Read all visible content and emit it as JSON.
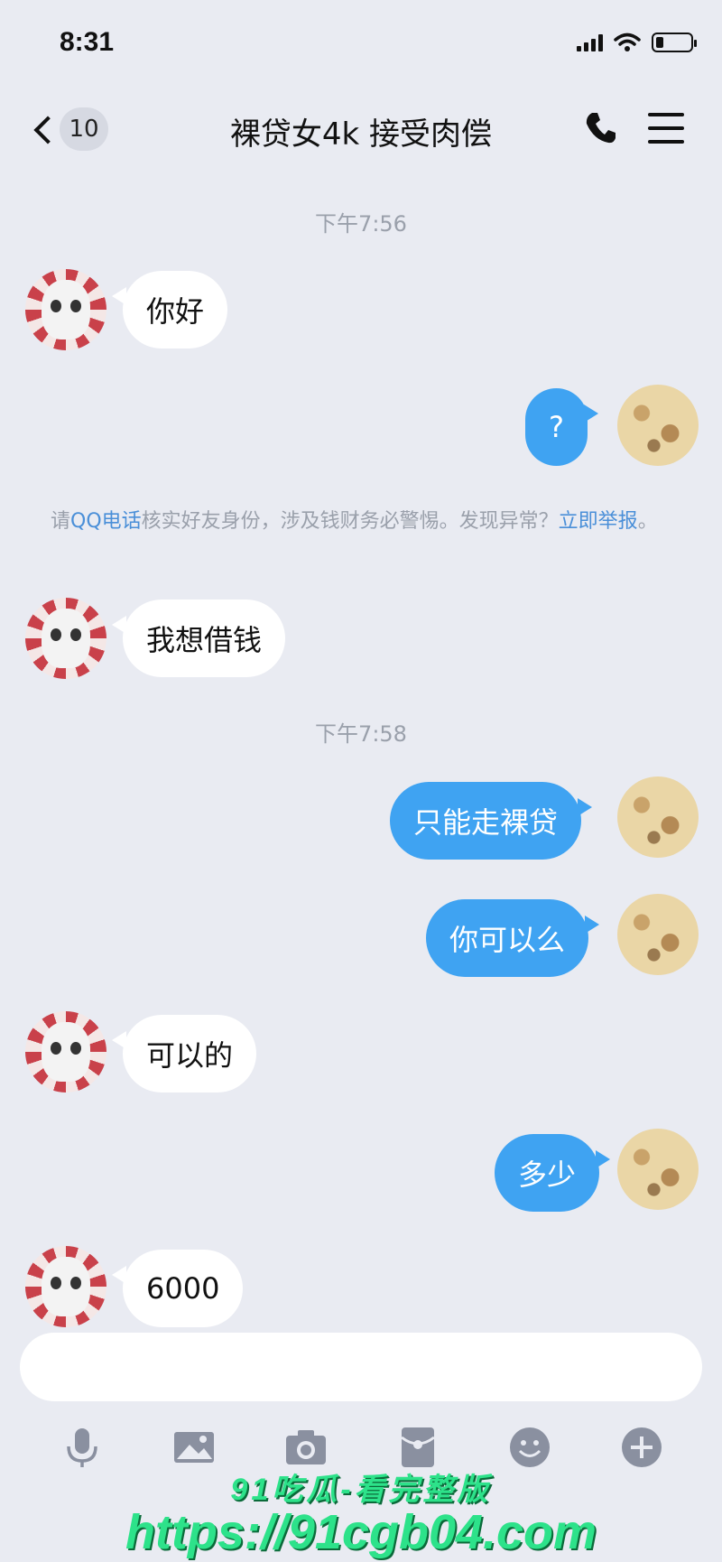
{
  "status_bar": {
    "time": "8:31"
  },
  "nav": {
    "unread_count": "10",
    "title": "裸贷女4k 接受肉偿"
  },
  "timestamps": [
    "下午7:56",
    "下午7:58"
  ],
  "messages": [
    {
      "side": "in",
      "text": "你好"
    },
    {
      "side": "out",
      "text": "?"
    },
    {
      "side": "in",
      "text": "我想借钱"
    },
    {
      "side": "out",
      "text": "只能走裸贷"
    },
    {
      "side": "out",
      "text": "你可以么"
    },
    {
      "side": "in",
      "text": "可以的"
    },
    {
      "side": "out",
      "text": "多少"
    },
    {
      "side": "in",
      "text": "6000"
    }
  ],
  "notice": {
    "prefix": "请",
    "link1": "QQ电话",
    "middle": "核实好友身份，涉及钱财务必警惕。发现异常？",
    "link2": "立即举报",
    "suffix": "。"
  },
  "toolbar": [
    "microphone-icon",
    "image-icon",
    "camera-icon",
    "red-packet-icon",
    "emoji-icon",
    "plus-icon"
  ],
  "watermark": {
    "line1": "91吃瓜-看完整版",
    "line2": "https://91cgb04.com"
  },
  "colors": {
    "background": "#e9ebf2",
    "outgoing_bubble": "#3fa3f2",
    "incoming_bubble": "#ffffff",
    "link": "#4a8fd8"
  }
}
